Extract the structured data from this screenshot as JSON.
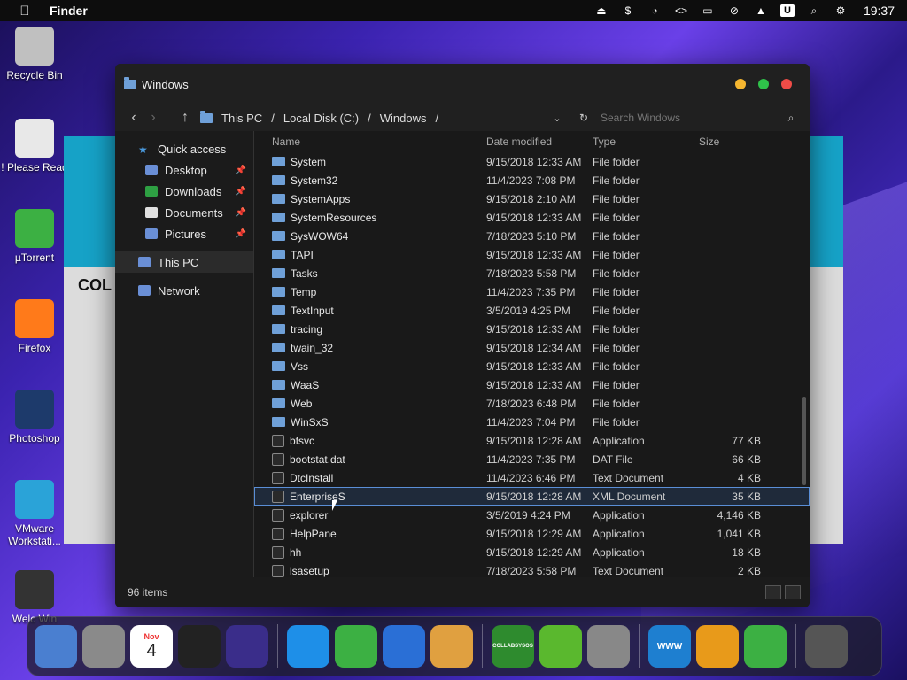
{
  "menubar": {
    "apple": "",
    "app_name": "Finder",
    "clock": "19:37",
    "status_icons": [
      "eject-icon",
      "dollar-icon",
      "clock-icon",
      "code-icon",
      "display-icon",
      "mute-icon",
      "upload-icon",
      "u-icon",
      "search-icon",
      "control-center-icon"
    ]
  },
  "desktop_icons": [
    {
      "label": "Recycle Bin",
      "icon": "trash-icon",
      "color": "#c0c0c0"
    },
    {
      "label": "! Please Read",
      "icon": "notepad-icon",
      "color": "#e8e8e8"
    },
    {
      "label": "µTorrent",
      "icon": "utorrent-icon",
      "color": "#3cb043"
    },
    {
      "label": "Firefox",
      "icon": "firefox-icon",
      "color": "#ff7a1a"
    },
    {
      "label": "Photoshop",
      "icon": "photoshop-icon",
      "color": "#1d3a6b"
    },
    {
      "label": "VMware Workstati...",
      "icon": "vmware-icon",
      "color": "#2aa3d8"
    },
    {
      "label": "Welc Win",
      "icon": "apple-icon",
      "color": "#333"
    }
  ],
  "background_window": {
    "heading": "COL"
  },
  "explorer": {
    "title": "Windows",
    "breadcrumb": [
      "This PC",
      "Local Disk (C:)",
      "Windows"
    ],
    "search_placeholder": "Search Windows",
    "nav": [
      {
        "label": "Quick access",
        "icon": "star-icon",
        "color": "#4a9ade",
        "sub": false,
        "pinned": false,
        "selected": false
      },
      {
        "label": "Desktop",
        "icon": "desktop-icon",
        "color": "#6a8fd6",
        "sub": true,
        "pinned": true,
        "selected": false
      },
      {
        "label": "Downloads",
        "icon": "download-icon",
        "color": "#2ea043",
        "sub": true,
        "pinned": true,
        "selected": false
      },
      {
        "label": "Documents",
        "icon": "documents-icon",
        "color": "#e0e0e0",
        "sub": true,
        "pinned": true,
        "selected": false
      },
      {
        "label": "Pictures",
        "icon": "pictures-icon",
        "color": "#6a8fd6",
        "sub": true,
        "pinned": true,
        "selected": false
      },
      {
        "label": "This PC",
        "icon": "pc-icon",
        "color": "#6a8fd6",
        "sub": false,
        "pinned": false,
        "selected": true
      },
      {
        "label": "Network",
        "icon": "network-icon",
        "color": "#6a8fd6",
        "sub": false,
        "pinned": false,
        "selected": false
      }
    ],
    "columns": {
      "name": "Name",
      "date": "Date modified",
      "type": "Type",
      "size": "Size"
    },
    "files": [
      {
        "name": "System",
        "date": "9/15/2018 12:33 AM",
        "type": "File folder",
        "size": "",
        "kind": "folder"
      },
      {
        "name": "System32",
        "date": "11/4/2023 7:08 PM",
        "type": "File folder",
        "size": "",
        "kind": "folder"
      },
      {
        "name": "SystemApps",
        "date": "9/15/2018 2:10 AM",
        "type": "File folder",
        "size": "",
        "kind": "folder"
      },
      {
        "name": "SystemResources",
        "date": "9/15/2018 12:33 AM",
        "type": "File folder",
        "size": "",
        "kind": "folder"
      },
      {
        "name": "SysWOW64",
        "date": "7/18/2023 5:10 PM",
        "type": "File folder",
        "size": "",
        "kind": "folder"
      },
      {
        "name": "TAPI",
        "date": "9/15/2018 12:33 AM",
        "type": "File folder",
        "size": "",
        "kind": "folder"
      },
      {
        "name": "Tasks",
        "date": "7/18/2023 5:58 PM",
        "type": "File folder",
        "size": "",
        "kind": "folder"
      },
      {
        "name": "Temp",
        "date": "11/4/2023 7:35 PM",
        "type": "File folder",
        "size": "",
        "kind": "folder"
      },
      {
        "name": "TextInput",
        "date": "3/5/2019 4:25 PM",
        "type": "File folder",
        "size": "",
        "kind": "folder"
      },
      {
        "name": "tracing",
        "date": "9/15/2018 12:33 AM",
        "type": "File folder",
        "size": "",
        "kind": "folder"
      },
      {
        "name": "twain_32",
        "date": "9/15/2018 12:34 AM",
        "type": "File folder",
        "size": "",
        "kind": "folder"
      },
      {
        "name": "Vss",
        "date": "9/15/2018 12:33 AM",
        "type": "File folder",
        "size": "",
        "kind": "folder"
      },
      {
        "name": "WaaS",
        "date": "9/15/2018 12:33 AM",
        "type": "File folder",
        "size": "",
        "kind": "folder"
      },
      {
        "name": "Web",
        "date": "7/18/2023 6:48 PM",
        "type": "File folder",
        "size": "",
        "kind": "folder"
      },
      {
        "name": "WinSxS",
        "date": "11/4/2023 7:04 PM",
        "type": "File folder",
        "size": "",
        "kind": "folder"
      },
      {
        "name": "bfsvc",
        "date": "9/15/2018 12:28 AM",
        "type": "Application",
        "size": "77 KB",
        "kind": "file"
      },
      {
        "name": "bootstat.dat",
        "date": "11/4/2023 7:35 PM",
        "type": "DAT File",
        "size": "66 KB",
        "kind": "file"
      },
      {
        "name": "DtcInstall",
        "date": "11/4/2023 6:46 PM",
        "type": "Text Document",
        "size": "4 KB",
        "kind": "file"
      },
      {
        "name": "EnterpriseS",
        "date": "9/15/2018 12:28 AM",
        "type": "XML Document",
        "size": "35 KB",
        "kind": "file",
        "highlighted": true
      },
      {
        "name": "explorer",
        "date": "3/5/2019 4:24 PM",
        "type": "Application",
        "size": "4,146 KB",
        "kind": "file"
      },
      {
        "name": "HelpPane",
        "date": "9/15/2018 12:29 AM",
        "type": "Application",
        "size": "1,041 KB",
        "kind": "file"
      },
      {
        "name": "hh",
        "date": "9/15/2018 12:29 AM",
        "type": "Application",
        "size": "18 KB",
        "kind": "file"
      },
      {
        "name": "lsasetup",
        "date": "7/18/2023 5:58 PM",
        "type": "Text Document",
        "size": "2 KB",
        "kind": "file"
      }
    ],
    "status": "96 items"
  },
  "dock": [
    {
      "name": "finder-icon",
      "label": "",
      "color": "#4a7fd0"
    },
    {
      "name": "launchpad-icon",
      "label": "",
      "color": "#8a8a8a"
    },
    {
      "name": "calendar-icon",
      "label": "4",
      "month": "Nov",
      "color": "#ffffff"
    },
    {
      "name": "clock-app-icon",
      "label": "",
      "color": "#222"
    },
    {
      "name": "siri-icon",
      "label": "",
      "color": "#3a2d8a"
    },
    {
      "name": "safari-icon",
      "label": "",
      "color": "#1e8fe8"
    },
    {
      "name": "utorrent-dock-icon",
      "label": "",
      "color": "#3cb043"
    },
    {
      "name": "windows-icon",
      "label": "",
      "color": "#2a6fd6"
    },
    {
      "name": "photos-icon",
      "label": "",
      "color": "#e0a040"
    },
    {
      "name": "collabsysos-icon",
      "label": "COLLABSYSOS",
      "color": "#2e8b2e"
    },
    {
      "name": "link-icon",
      "label": "",
      "color": "#5ab82e"
    },
    {
      "name": "tools-icon",
      "label": "",
      "color": "#888"
    },
    {
      "name": "www-icon",
      "label": "WWW",
      "color": "#1e7fd0"
    },
    {
      "name": "download-dock-icon",
      "label": "",
      "color": "#e89a1a"
    },
    {
      "name": "people-icon",
      "label": "",
      "color": "#3cb043"
    },
    {
      "name": "trash-dock-icon",
      "label": "",
      "color": "#555"
    }
  ]
}
